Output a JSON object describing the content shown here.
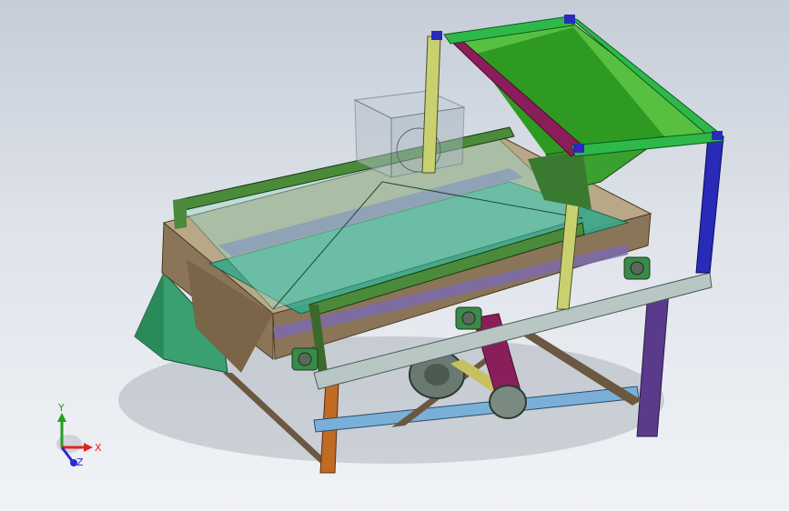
{
  "viewport": {
    "background_top": "#c6cdd8",
    "background_bottom": "#f1f3f6"
  },
  "triad": {
    "x_label": "X",
    "y_label": "Y",
    "z_label": "Z",
    "x_color": "#e02424",
    "y_color": "#20a020",
    "z_color": "#2a2ad0"
  },
  "model": {
    "parts": [
      "hopper-frame-icon",
      "hopper-icon",
      "screen-box-icon",
      "screen-deck-icon",
      "bearing-block-icon",
      "drive-pulley-icon",
      "support-legs-icon"
    ],
    "colors": {
      "hopper": "#2f9a22",
      "hopper_frame_top": "#2fb84a",
      "hopper_frame_side": "#8a1e5a",
      "box": "#8b7558",
      "deck": "#3aa88a",
      "rail": "#b8c7c4",
      "leg_orange": "#c06a22",
      "leg_purple": "#5a3a8a",
      "leg_blue": "#2a2ab8",
      "brace_blue": "#7ab0d8"
    }
  }
}
